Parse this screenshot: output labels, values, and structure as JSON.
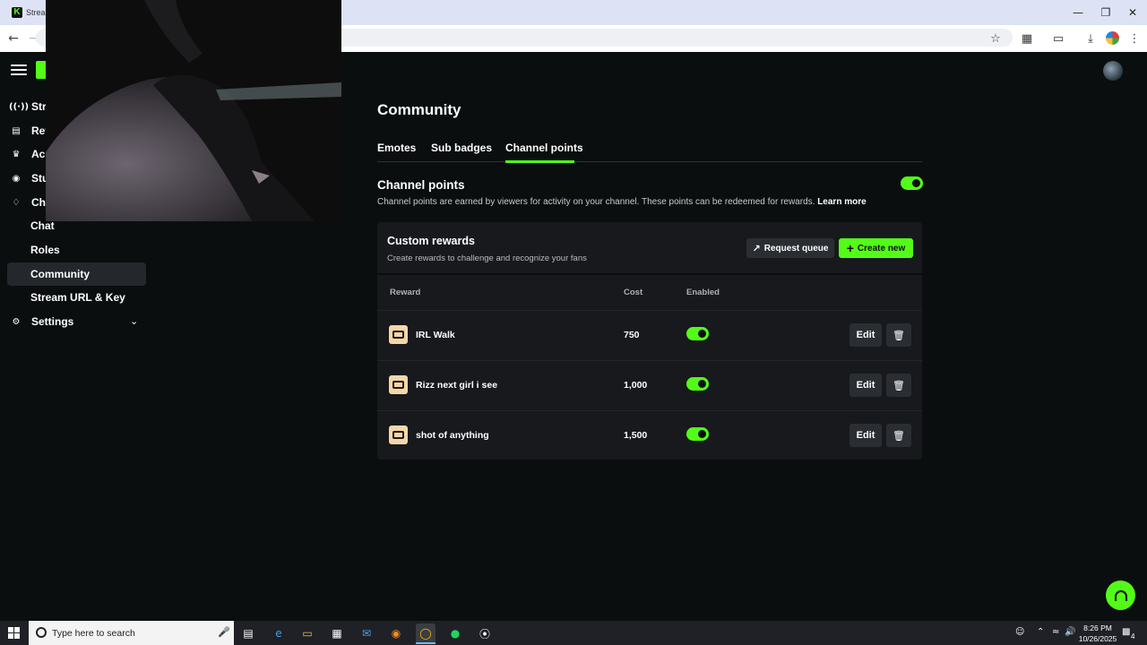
{
  "browser": {
    "tab_title": "Stream",
    "favicon_letter": "K",
    "window_controls": [
      "minimize",
      "restore",
      "close"
    ]
  },
  "sidebar": {
    "items": [
      {
        "label": "Stre",
        "icon": "broadcast-icon"
      },
      {
        "label": "Rev",
        "icon": "chart-icon"
      },
      {
        "label": "Achi",
        "icon": "trophy-icon"
      },
      {
        "label": "Stu",
        "icon": "camera-icon"
      },
      {
        "label": "Cha",
        "icon": "channel-icon"
      }
    ],
    "sub_items": [
      {
        "label": "Chat"
      },
      {
        "label": "Roles"
      },
      {
        "label": "Community"
      },
      {
        "label": "Stream URL & Key"
      }
    ],
    "settings": {
      "label": "Settings",
      "icon": "gear-icon"
    }
  },
  "main": {
    "title": "Community",
    "tabs": [
      {
        "label": "Emotes"
      },
      {
        "label": "Sub badges"
      },
      {
        "label": "Channel points"
      }
    ],
    "active_tab": "Channel points",
    "channel_points": {
      "heading": "Channel points",
      "description": "Channel points are earned by viewers for activity on your channel. These points can be redeemed for rewards.",
      "learn_more": "Learn more",
      "enabled": true
    },
    "custom_rewards": {
      "title": "Custom rewards",
      "subtitle": "Create rewards to challenge and recognize your fans",
      "request_queue_label": "Request queue",
      "create_new_label": "Create new",
      "columns": [
        "Reward",
        "Cost",
        "Enabled"
      ],
      "rows": [
        {
          "name": "IRL Walk",
          "cost": "750",
          "enabled": true,
          "edit_label": "Edit"
        },
        {
          "name": "Rizz next girl i see",
          "cost": "1,000",
          "enabled": true,
          "edit_label": "Edit"
        },
        {
          "name": "shot of anything",
          "cost": "1,500",
          "enabled": true,
          "edit_label": "Edit"
        }
      ]
    }
  },
  "taskbar": {
    "search_placeholder": "Type here to search",
    "time": "8:26 PM",
    "date": "10/26/2025",
    "notification_count": "4"
  },
  "colors": {
    "accent": "#53fc18",
    "background": "#0b0e0f",
    "card": "#17191c"
  }
}
